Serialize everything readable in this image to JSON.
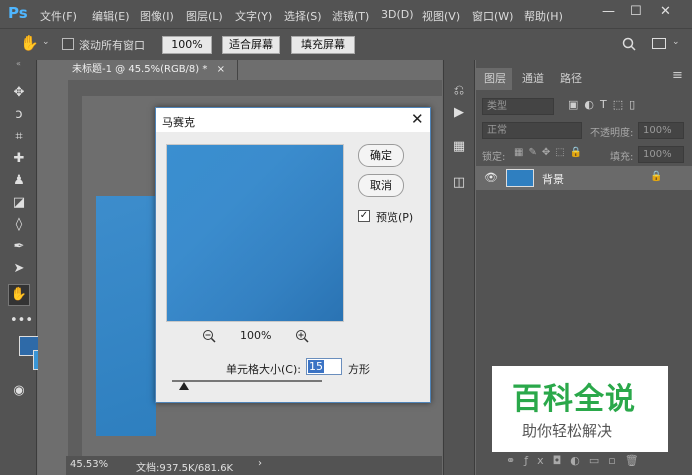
{
  "app": {
    "logo": "Ps"
  },
  "menubar": {
    "items": [
      "文件(F)",
      "编辑(E)",
      "图像(I)",
      "图层(L)",
      "文字(Y)",
      "选择(S)",
      "滤镜(T)",
      "3D(D)",
      "视图(V)",
      "窗口(W)",
      "帮助(H)"
    ]
  },
  "window_controls": {
    "minimize": "—",
    "maximize": "☐",
    "close": "✕"
  },
  "options": {
    "scroll_all_label": "滚动所有窗口",
    "zoom_value": "100%",
    "fit_screen_label": "适合屏幕",
    "fill_screen_label": "填充屏幕"
  },
  "document": {
    "tab_title": "未标题-1 @ 45.5%(RGB/8) *",
    "close": "×"
  },
  "status": {
    "zoom": "45.53%",
    "doc_info": "文档:937.5K/681.6K",
    "arrow": "›"
  },
  "layers_panel": {
    "tabs": [
      "图层",
      "通道",
      "路径"
    ],
    "filter_label": "类型",
    "blend_mode": "正常",
    "opacity_label": "不透明度:",
    "opacity_value": "100%",
    "lock_label": "锁定:",
    "fill_label": "填充:",
    "fill_value": "100%",
    "layer_name": "背景"
  },
  "dialog": {
    "title": "马赛克",
    "ok_label": "确定",
    "cancel_label": "取消",
    "preview_label": "预览(P)",
    "preview_checked": true,
    "zoom_value": "100%",
    "cell_size_label": "单元格大小(C):",
    "cell_size_value": "15",
    "unit": "方形",
    "slider_level": 0.03
  },
  "watermark": {
    "title": "百科全说",
    "subtitle": "助你轻松解决"
  },
  "colors": {
    "foreground": "#2e6aa8",
    "background": "#3a96d6",
    "watermark_green": "#2aa84a",
    "dialog_border": "#4f84b8"
  }
}
